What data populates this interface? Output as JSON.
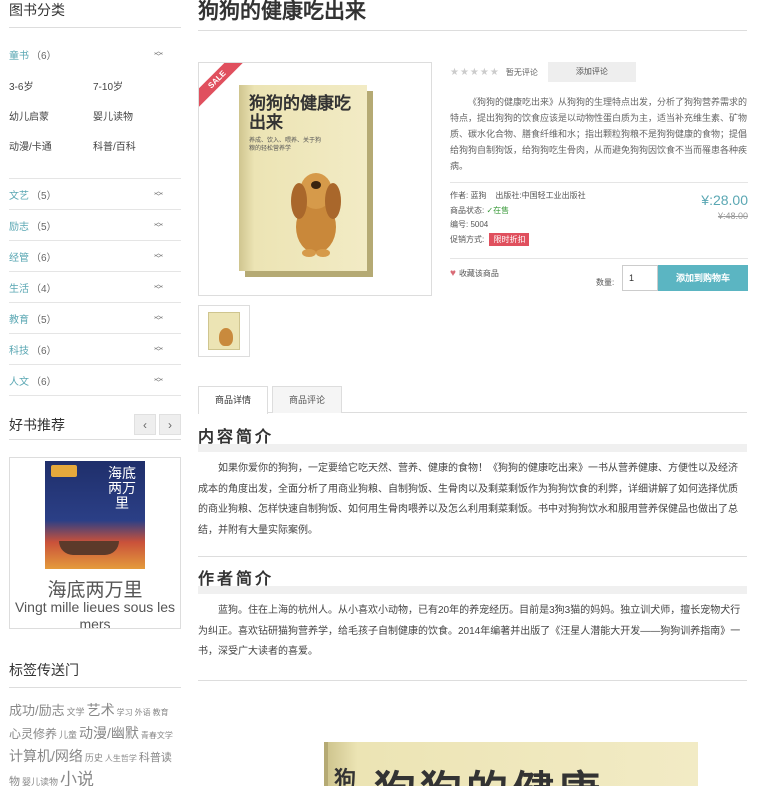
{
  "sidebar": {
    "category_title": "图书分类",
    "categories": [
      {
        "name": "童书",
        "count": "（6）"
      },
      {
        "name": "文艺",
        "count": "（5）"
      },
      {
        "name": "励志",
        "count": "（5）"
      },
      {
        "name": "经管",
        "count": "（6）"
      },
      {
        "name": "生活",
        "count": "（4）"
      },
      {
        "name": "教育",
        "count": "（5）"
      },
      {
        "name": "科技",
        "count": "（6）"
      },
      {
        "name": "人文",
        "count": "（6）"
      }
    ],
    "subcategories": [
      "3-6岁",
      "7-10岁",
      "幼儿启蒙",
      "婴儿读物",
      "动漫/卡通",
      "科普/百科"
    ],
    "recommend_title": "好书推荐",
    "prev_icon": "chevron-left-icon",
    "next_icon": "chevron-right-icon",
    "recommend_book": {
      "cover_title": "海底两万里",
      "name": "海底两万里",
      "subtitle": "Vingt mille lieues sous les mers"
    },
    "tags_title": "标签传送门",
    "tags": [
      {
        "text": "成功/励志",
        "size": 13
      },
      {
        "text": "文学",
        "size": 9
      },
      {
        "text": "艺术",
        "size": 14
      },
      {
        "text": "学习",
        "size": 8
      },
      {
        "text": "外语",
        "size": 8
      },
      {
        "text": "教育",
        "size": 8
      },
      {
        "text": "心灵修养",
        "size": 12
      },
      {
        "text": "儿童",
        "size": 9
      },
      {
        "text": "动漫/幽默",
        "size": 14
      },
      {
        "text": "青春文学",
        "size": 8
      },
      {
        "text": "计算机/网络",
        "size": 14
      },
      {
        "text": "历史",
        "size": 9
      },
      {
        "text": "人生哲学",
        "size": 8
      },
      {
        "text": "科普读物",
        "size": 11
      },
      {
        "text": "婴儿读物",
        "size": 9
      },
      {
        "text": "小说",
        "size": 17
      }
    ]
  },
  "product": {
    "title": "狗狗的健康吃出来",
    "sale_badge": "SALE",
    "cover_title": "狗狗的健康吃出来",
    "cover_subtitle": "养成、饮入、喂养、关于狗粮的轻松营养学",
    "rating_stars": "★★★★★",
    "no_review_text": "暂无评论",
    "add_review_label": "添加评论",
    "description": "《狗狗的健康吃出来》从狗狗的生理特点出发，分析了狗狗营养需求的特点，提出狗狗的饮食应该是以动物性蛋白质为主，适当补充维生素、矿物质、碳水化合物、膳食纤维和水；指出颗粒狗粮不是狗狗健康的食物；提倡给狗狗自制狗饭，给狗狗吃生骨肉，从而避免狗狗因饮食不当而罹患各种疾病。",
    "author_label": "作者: ",
    "author": "蓝狗",
    "publisher_label": "出版社:",
    "publisher": "中国轻工业出版社",
    "status_label": "商品状态: ",
    "status_icon": "check-icon",
    "status": "在售",
    "code_label": "编号: ",
    "code": "5004",
    "promo_label": "促销方式: ",
    "promo": "限时折扣",
    "price": "¥:28.00",
    "old_price": "¥:48.00",
    "favorite_label": "收藏该商品",
    "quantity_label": "数量:",
    "quantity": "1",
    "add_to_cart_label": "添加到购物车"
  },
  "tabs": [
    {
      "label": "商品详情",
      "active": true
    },
    {
      "label": "商品评论",
      "active": false
    }
  ],
  "content": {
    "intro_title": "内容简介",
    "intro_text": "如果你爱你的狗狗，一定要给它吃天然、营养、健康的食物！《狗狗的健康吃出来》一书从营养健康、方便性以及经济成本的角度出发，全面分析了用商业狗粮、自制狗饭、生骨肉以及剩菜剩饭作为狗狗饮食的利弊，详细讲解了如何选择优质的商业狗粮、怎样快速自制狗饭、如何用生骨肉喂养以及怎么利用剩菜剩饭。书中对狗狗饮水和服用营养保健品也做出了总结，并附有大量实际案例。",
    "author_title": "作者简介",
    "author_text": "蓝狗。住在上海的杭州人。从小喜欢小动物，已有20年的养宠经历。目前是3狗3猫的妈妈。独立训犬师，擅长宠物犬行为纠正。喜欢钻研猫狗营养学，给毛孩子自制健康的饮食。2014年编著并出版了《汪星人潜能大开发——狗狗训养指南》一书，深受广大读者的喜爱。",
    "big_cover_text": "狗狗的健康",
    "big_cover_side": "狗"
  }
}
